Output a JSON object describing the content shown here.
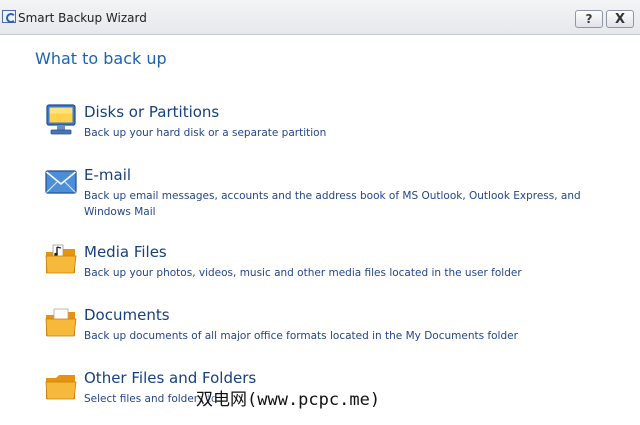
{
  "window": {
    "title": "Smart Backup Wizard",
    "help_label": "?",
    "close_label": "X"
  },
  "section_title": "What to back up",
  "options": [
    {
      "title": "Disks or Partitions",
      "description": "Back up your hard disk or a separate partition",
      "icon": "computer-monitor-icon"
    },
    {
      "title": "E-mail",
      "description": "Back up email messages, accounts and the address book of MS Outlook, Outlook Express, and Windows Mail",
      "icon": "envelope-icon"
    },
    {
      "title": "Media Files",
      "description": "Back up your photos, videos, music and other media files located in the user folder",
      "icon": "media-folder-icon"
    },
    {
      "title": "Documents",
      "description": "Back up documents of all major office formats located in the My Documents folder",
      "icon": "documents-folder-icon"
    },
    {
      "title": "Other Files and Folders",
      "description": "Select files and folders to",
      "icon": "folder-icon"
    }
  ],
  "watermark": "双电网(www.pcpc.me)",
  "colors": {
    "heading": "#1b62b3",
    "option_title": "#16407e",
    "option_desc": "#24458a",
    "folder": "#f2a51a"
  }
}
